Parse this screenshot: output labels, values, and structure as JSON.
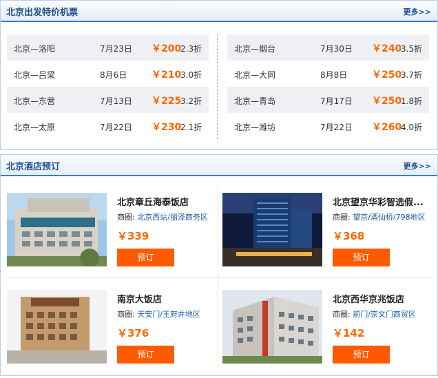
{
  "flights": {
    "title": "北京出发特价机票",
    "more": "更多>>",
    "left": [
      {
        "route": "北京—洛阳",
        "date": "7月23日",
        "price": "￥200",
        "discount": "2.3折"
      },
      {
        "route": "北京—吕梁",
        "date": "8月6日",
        "price": "￥210",
        "discount": "3.0折"
      },
      {
        "route": "北京—东营",
        "date": "7月13日",
        "price": "￥225",
        "discount": "3.2折"
      },
      {
        "route": "北京—太原",
        "date": "7月22日",
        "price": "￥230",
        "discount": "2.1折"
      }
    ],
    "right": [
      {
        "route": "北京—烟台",
        "date": "7月30日",
        "price": "￥240",
        "discount": "3.5折"
      },
      {
        "route": "北京—大同",
        "date": "8月8日",
        "price": "￥250",
        "discount": "3.7折"
      },
      {
        "route": "北京—青岛",
        "date": "7月17日",
        "price": "￥250",
        "discount": "1.8折"
      },
      {
        "route": "北京—潍坊",
        "date": "7月22日",
        "price": "￥260",
        "discount": "4.0折"
      }
    ]
  },
  "hotels": {
    "title": "北京酒店预订",
    "more": "更多>>",
    "area_label": "商圈:",
    "book_label": "预订",
    "items": [
      {
        "name": "北京章丘海泰饭店",
        "area": "北京西站/丽泽商务区",
        "price": "￥339"
      },
      {
        "name": "北京望京华彩智选假...",
        "area": "望京/酒仙桥/798地区",
        "price": "￥368"
      },
      {
        "name": "南京大饭店",
        "area": "天安门/王府井地区",
        "price": "￥376"
      },
      {
        "name": "北京西华京兆饭店",
        "area": "前门/崇文门商贸区",
        "price": "￥142"
      }
    ]
  },
  "colors": {
    "accent": "#1f4f8c",
    "price": "#ff6600",
    "button": "#ff5a00"
  }
}
